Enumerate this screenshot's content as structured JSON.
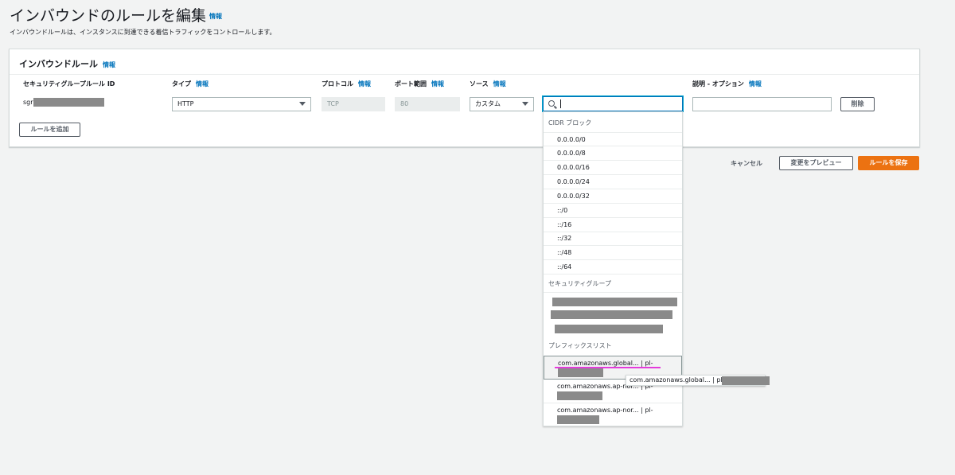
{
  "page": {
    "title": "インバウンドのルールを編集",
    "info": "情報",
    "description": "インバウンドルールは、インスタンスに到達できる着信トラフィックをコントロールします。"
  },
  "panel": {
    "title": "インバウンドルール",
    "info": "情報",
    "columns": {
      "rule_id": "セキュリティグループルール ID",
      "type": "タイプ",
      "protocol": "プロトコル",
      "port_range": "ポート範囲",
      "source": "ソース",
      "description": "説明 - オプション"
    },
    "row": {
      "rule_id_prefix": "sgr",
      "type_value": "HTTP",
      "protocol_value": "TCP",
      "port_value": "80",
      "source_value": "カスタム",
      "search_value": "",
      "description_value": "",
      "delete_label": "削除"
    },
    "add_rule_label": "ルールを追加"
  },
  "footer": {
    "cancel_label": "キャンセル",
    "preview_label": "変更をプレビュー",
    "save_label": "ルールを保存"
  },
  "dropdown": {
    "cidr_group_label": "CIDR ブロック",
    "cidr_options": [
      "0.0.0.0/0",
      "0.0.0.0/8",
      "0.0.0.0/16",
      "0.0.0.0/24",
      "0.0.0.0/32",
      "::/0",
      "::/16",
      "::/32",
      "::/48",
      "::/64"
    ],
    "sg_group_label": "セキュリティグループ",
    "prefix_group_label": "プレフィックスリスト",
    "prefix_items": [
      "com.amazonaws.global... | pl-",
      "com.amazonaws.ap-nor... | pl-",
      "com.amazonaws.ap-nor... | pl-"
    ],
    "tooltip": "com.amazonaws.global... | pl"
  },
  "colors": {
    "accent": "#0073bb",
    "primary_button": "#ec7211",
    "highlight_line": "#e43bdb",
    "redaction": "#8a8a8a"
  }
}
